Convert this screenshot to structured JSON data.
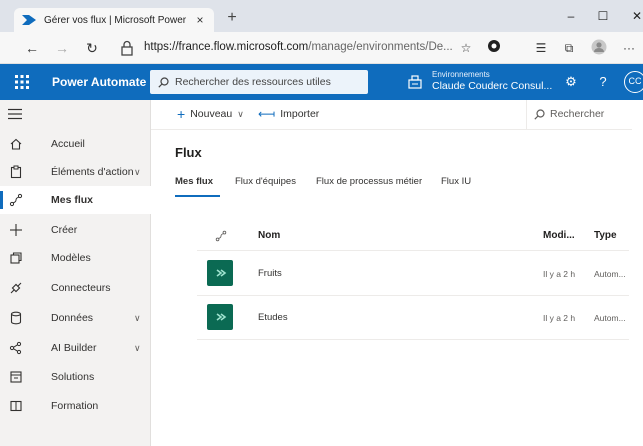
{
  "browser": {
    "tab_title": "Gérer vos flux | Microsoft Power",
    "tab_close": "×",
    "new_tab": "+",
    "url_domain": "https://france.flow.microsoft.com",
    "url_path": "/manage/environments/De...",
    "window": {
      "minimize": "–",
      "maximize": "☐",
      "close": "✕"
    },
    "toolbar_more": "···",
    "back": "←",
    "forward": "→",
    "refresh": "↻"
  },
  "header": {
    "app_title": "Power Automate",
    "search_placeholder": "Rechercher des ressources utiles",
    "env_label": "Environnements",
    "env_name": "Claude Couderc Consul...",
    "help": "?",
    "avatar": "CC"
  },
  "sidebar": {
    "items": [
      {
        "label": "Accueil",
        "icon": "home-icon"
      },
      {
        "label": "Éléments d'action",
        "icon": "clipboard-icon",
        "chevron": "∨"
      },
      {
        "label": "Mes flux",
        "icon": "flow-icon",
        "active": true
      },
      {
        "label": "Créer",
        "icon": "plus-icon"
      },
      {
        "label": "Modèles",
        "icon": "templates-icon"
      },
      {
        "label": "Connecteurs",
        "icon": "connector-icon"
      },
      {
        "label": "Données",
        "icon": "database-icon",
        "chevron": "∨"
      },
      {
        "label": "AI Builder",
        "icon": "ai-icon",
        "chevron": "∨"
      },
      {
        "label": "Solutions",
        "icon": "solutions-icon"
      },
      {
        "label": "Formation",
        "icon": "book-icon"
      }
    ]
  },
  "commands": {
    "new_label": "Nouveau",
    "new_chevron": "∨",
    "import_label": "Importer",
    "search_label": "Rechercher"
  },
  "page": {
    "title": "Flux",
    "tabs": [
      "Mes flux",
      "Flux d'équipes",
      "Flux de processus métier",
      "Flux IU"
    ]
  },
  "table": {
    "columns": [
      "Nom",
      "Modi...",
      "Type"
    ],
    "rows": [
      {
        "name": "Fruits",
        "modified": "Il y a 2 h",
        "type": "Autom..."
      },
      {
        "name": "Etudes",
        "modified": "Il y a 2 h",
        "type": "Autom..."
      }
    ]
  },
  "colors": {
    "brand": "#0f6cbd",
    "flow_icon": "#0b6a53"
  }
}
